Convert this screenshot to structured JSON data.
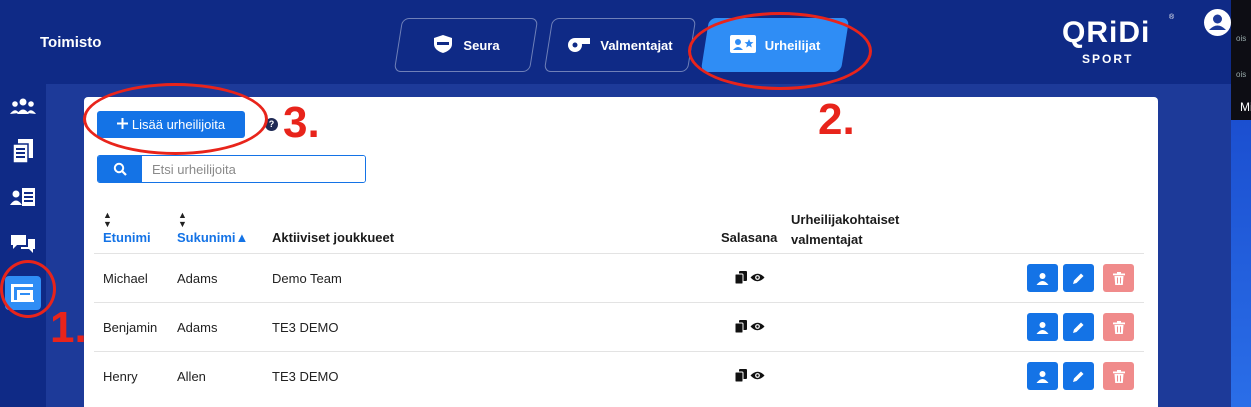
{
  "header": {
    "title": "Toimisto",
    "tabs": [
      {
        "label": "Seura",
        "active": false,
        "icon": "shield-icon"
      },
      {
        "label": "Valmentajat",
        "active": false,
        "icon": "whistle-icon"
      },
      {
        "label": "Urheilijat",
        "active": true,
        "icon": "athlete-card-icon"
      }
    ],
    "logo": {
      "main": "QRiDi",
      "sub": "SPORT",
      "reg": "®"
    }
  },
  "sidebar": {
    "items": [
      {
        "icon": "team-icon",
        "active": false
      },
      {
        "icon": "document-list-icon",
        "active": false
      },
      {
        "icon": "user-list-icon",
        "active": false
      },
      {
        "icon": "chat-icon",
        "active": false
      },
      {
        "icon": "office-desk-icon",
        "active": true
      }
    ]
  },
  "toolbar": {
    "add_label": "Lisää urheilijoita",
    "help": "?"
  },
  "search": {
    "placeholder": "Etsi urheilijoita"
  },
  "table": {
    "headers": {
      "first_name": "Etunimi",
      "last_name": "Sukunimi▲",
      "teams": "Aktiiviset joukkueet",
      "password": "Salasana",
      "coaches": "Urheilijakohtaiset valmentajat"
    },
    "rows": [
      {
        "first": "Michael",
        "last": "Adams",
        "team": "Demo Team"
      },
      {
        "first": "Benjamin",
        "last": "Adams",
        "team": "TE3 DEMO"
      },
      {
        "first": "Henry",
        "last": "Allen",
        "team": "TE3 DEMO"
      }
    ]
  },
  "annotations": {
    "one": "1.",
    "two": "2.",
    "three": "3."
  },
  "strip": {
    "top": "ois",
    "side": "Mi"
  },
  "colors": {
    "primary": "#1473e6",
    "header": "#0f2a86",
    "active_tab": "#2f8df5",
    "delete": "#f08b8b",
    "annotation": "#e8241b"
  }
}
